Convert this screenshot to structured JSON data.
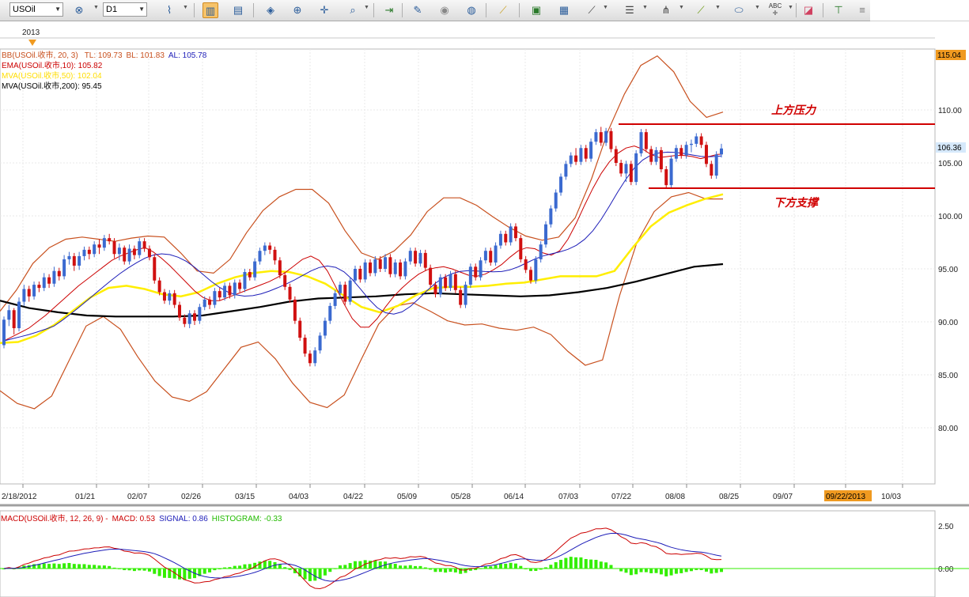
{
  "toolbar": {
    "symbol": "USOil",
    "timeframe": "D1",
    "icons": [
      "bar-chart-icon",
      "indicator-icon",
      "period-icon",
      "objects-icon",
      "zoom-in-icon",
      "zoom-out-icon",
      "crosshair-icon",
      "search-chart-icon",
      "auto-scroll-icon",
      "edit-icon",
      "eye-icon",
      "globe-icon",
      "ruler-icon",
      "picture-icon",
      "chart-window-icon",
      "trendline-icon",
      "fibonacci-icon",
      "pitchfork-icon",
      "line-tool-icon",
      "ellipse-icon",
      "text-label-icon",
      "eraser-icon",
      "tree-icon",
      "menu-icon"
    ]
  },
  "colors": {
    "bull": "#3b6ad0",
    "bear": "#d01010",
    "bb": "#c8501e",
    "ema": "#cc0000",
    "mva50": "#ffee00",
    "mva200": "#000000",
    "macd": "#cc0000",
    "signal": "#1d1db8",
    "hist": "#33ee00",
    "levels": "#d00000",
    "price_tag": "#d6e9fb",
    "date_tag": "#f09a20"
  },
  "legend": {
    "bb_name": "BB(USOil.收市, 20, 3)",
    "bb_tl": "TL: 109.73",
    "bb_bl": "BL: 101.83",
    "bb_al": "AL: 105.78",
    "ema": "EMA(USOil.收市,10): 105.82",
    "mva50": "MVA(USOil.收市,50): 102.04",
    "mva200": "MVA(USOil.收市,200): 95.45"
  },
  "annotations": {
    "resistance": "上方压力",
    "support": "下方支撑"
  },
  "year_label": "2013",
  "price_tag_top": "115.04",
  "price_tag_last": "106.36",
  "date_tag": "09/22/2013",
  "macd_legend": {
    "name": "MACD(USOil.收市, 12, 26, 9) -",
    "macd": "MACD: 0.53",
    "signal": "SIGNAL: 0.86",
    "hist": "HISTOGRAM: -0.33"
  },
  "chart_data": [
    {
      "type": "candlestick",
      "symbol": "USOil",
      "timeframe": "D1",
      "y_ticks": [
        80,
        85,
        90,
        95,
        100,
        105,
        110
      ],
      "ylim": [
        75,
        115.04
      ],
      "last_price": 106.36,
      "x_tick_labels": [
        "2/18/2012",
        "01/21",
        "02/07",
        "02/26",
        "03/15",
        "04/03",
        "04/22",
        "05/09",
        "05/28",
        "06/14",
        "07/03",
        "07/22",
        "08/08",
        "08/25",
        "09/07",
        "09/22/2013",
        "10/03"
      ],
      "ohlc": [
        [
          87.8,
          90.5,
          87.5,
          90.2
        ],
        [
          90.2,
          91.6,
          89.6,
          91.1
        ],
        [
          91.1,
          91.3,
          88.8,
          89.4
        ],
        [
          89.4,
          92.3,
          89.1,
          91.9
        ],
        [
          91.9,
          93.5,
          91.5,
          93.1
        ],
        [
          93.1,
          93.4,
          91.9,
          92.4
        ],
        [
          92.4,
          93.8,
          92.1,
          93.5
        ],
        [
          93.5,
          93.8,
          92.8,
          93.2
        ],
        [
          93.2,
          94.6,
          92.9,
          94.2
        ],
        [
          94.2,
          94.5,
          93.2,
          93.6
        ],
        [
          93.6,
          95.2,
          93.3,
          94.8
        ],
        [
          94.8,
          95.1,
          93.9,
          94.3
        ],
        [
          94.3,
          96.3,
          94.0,
          95.9
        ],
        [
          95.9,
          96.6,
          95.4,
          96.2
        ],
        [
          96.2,
          96.5,
          94.8,
          95.3
        ],
        [
          95.3,
          96.6,
          94.9,
          96.2
        ],
        [
          96.2,
          97.1,
          95.8,
          96.8
        ],
        [
          96.8,
          97.1,
          95.9,
          96.4
        ],
        [
          96.4,
          97.6,
          96.1,
          97.3
        ],
        [
          97.3,
          97.8,
          96.4,
          97.0
        ],
        [
          97.0,
          98.2,
          96.7,
          97.9
        ],
        [
          97.9,
          98.3,
          97.3,
          97.6
        ],
        [
          97.6,
          97.9,
          96.0,
          96.4
        ],
        [
          96.4,
          97.4,
          95.8,
          97.0
        ],
        [
          97.0,
          97.2,
          95.4,
          95.7
        ],
        [
          95.7,
          97.3,
          95.4,
          96.9
        ],
        [
          96.9,
          97.2,
          95.9,
          96.3
        ],
        [
          96.3,
          97.9,
          96.0,
          97.6
        ],
        [
          97.6,
          97.9,
          96.6,
          96.9
        ],
        [
          96.9,
          97.2,
          95.8,
          96.1
        ],
        [
          96.1,
          96.4,
          93.6,
          93.9
        ],
        [
          93.9,
          94.2,
          92.5,
          92.8
        ],
        [
          92.8,
          93.1,
          91.7,
          92.0
        ],
        [
          92.0,
          93.0,
          91.6,
          92.7
        ],
        [
          92.7,
          93.0,
          91.3,
          91.6
        ],
        [
          91.6,
          91.9,
          90.1,
          90.4
        ],
        [
          90.4,
          90.7,
          89.5,
          89.8
        ],
        [
          89.8,
          91.1,
          89.4,
          90.8
        ],
        [
          90.8,
          91.1,
          89.7,
          90.1
        ],
        [
          90.1,
          91.7,
          89.8,
          91.4
        ],
        [
          91.4,
          92.4,
          91.1,
          92.1
        ],
        [
          92.1,
          92.4,
          91.2,
          91.6
        ],
        [
          91.6,
          93.2,
          91.3,
          92.9
        ],
        [
          92.9,
          93.2,
          92.0,
          92.3
        ],
        [
          92.3,
          93.7,
          92.0,
          93.4
        ],
        [
          93.4,
          93.7,
          92.2,
          92.5
        ],
        [
          92.5,
          94.0,
          92.2,
          93.7
        ],
        [
          93.7,
          94.0,
          92.8,
          93.1
        ],
        [
          93.1,
          95.0,
          92.8,
          94.7
        ],
        [
          94.7,
          95.0,
          93.9,
          94.2
        ],
        [
          94.2,
          96.0,
          93.9,
          95.7
        ],
        [
          95.7,
          97.0,
          95.4,
          96.7
        ],
        [
          96.7,
          97.5,
          96.3,
          97.2
        ],
        [
          97.2,
          97.5,
          96.4,
          96.8
        ],
        [
          96.8,
          97.1,
          95.4,
          95.8
        ],
        [
          95.8,
          96.1,
          94.1,
          94.4
        ],
        [
          94.4,
          94.7,
          93.0,
          93.3
        ],
        [
          93.3,
          93.6,
          91.8,
          92.1
        ],
        [
          92.1,
          92.4,
          89.8,
          90.1
        ],
        [
          90.1,
          90.4,
          88.2,
          88.5
        ],
        [
          88.5,
          88.8,
          86.7,
          87.0
        ],
        [
          87.0,
          87.3,
          85.8,
          86.1
        ],
        [
          86.1,
          87.6,
          85.8,
          87.3
        ],
        [
          87.3,
          89.0,
          87.0,
          88.7
        ],
        [
          88.7,
          90.4,
          88.4,
          90.1
        ],
        [
          90.1,
          91.8,
          89.8,
          91.5
        ],
        [
          91.5,
          93.0,
          91.2,
          92.7
        ],
        [
          92.7,
          93.8,
          92.4,
          93.5
        ],
        [
          93.5,
          93.8,
          91.6,
          91.9
        ],
        [
          91.9,
          94.2,
          91.6,
          93.9
        ],
        [
          93.9,
          95.3,
          93.6,
          95.0
        ],
        [
          95.0,
          95.3,
          93.7,
          94.0
        ],
        [
          94.0,
          95.9,
          93.7,
          95.6
        ],
        [
          95.6,
          95.9,
          94.3,
          94.6
        ],
        [
          94.6,
          96.2,
          94.3,
          95.9
        ],
        [
          95.9,
          96.2,
          94.7,
          95.0
        ],
        [
          95.0,
          96.4,
          94.7,
          96.1
        ],
        [
          96.1,
          96.4,
          94.2,
          94.5
        ],
        [
          94.5,
          95.9,
          94.2,
          95.6
        ],
        [
          95.6,
          95.9,
          94.0,
          94.3
        ],
        [
          94.3,
          96.0,
          94.0,
          95.7
        ],
        [
          95.7,
          97.0,
          95.4,
          96.7
        ],
        [
          96.7,
          97.0,
          95.2,
          95.5
        ],
        [
          95.5,
          96.8,
          95.2,
          96.5
        ],
        [
          96.5,
          96.8,
          94.8,
          95.1
        ],
        [
          95.1,
          95.4,
          93.2,
          93.5
        ],
        [
          93.5,
          93.8,
          92.3,
          92.6
        ],
        [
          92.6,
          94.5,
          92.3,
          94.2
        ],
        [
          94.2,
          94.5,
          92.9,
          93.2
        ],
        [
          93.2,
          94.8,
          92.9,
          94.5
        ],
        [
          94.5,
          94.8,
          92.7,
          93.0
        ],
        [
          93.0,
          93.3,
          91.3,
          91.6
        ],
        [
          91.6,
          93.8,
          91.3,
          93.5
        ],
        [
          93.5,
          95.5,
          93.2,
          95.2
        ],
        [
          95.2,
          95.5,
          93.9,
          94.2
        ],
        [
          94.2,
          96.1,
          93.9,
          95.8
        ],
        [
          95.8,
          97.0,
          95.5,
          96.7
        ],
        [
          96.7,
          97.0,
          95.3,
          95.6
        ],
        [
          95.6,
          97.5,
          95.3,
          97.2
        ],
        [
          97.2,
          98.6,
          96.9,
          98.3
        ],
        [
          98.3,
          98.6,
          97.2,
          97.5
        ],
        [
          97.5,
          99.3,
          97.2,
          99.0
        ],
        [
          99.0,
          99.3,
          97.6,
          97.9
        ],
        [
          97.9,
          98.2,
          95.6,
          95.9
        ],
        [
          95.9,
          96.2,
          94.6,
          94.9
        ],
        [
          94.9,
          95.2,
          93.6,
          93.9
        ],
        [
          93.9,
          96.2,
          93.6,
          95.9
        ],
        [
          95.9,
          97.6,
          95.6,
          97.3
        ],
        [
          97.3,
          99.5,
          97.0,
          99.2
        ],
        [
          99.2,
          101.0,
          98.9,
          100.7
        ],
        [
          100.7,
          102.5,
          100.4,
          102.2
        ],
        [
          102.2,
          104.0,
          101.9,
          103.7
        ],
        [
          103.7,
          105.2,
          103.4,
          104.9
        ],
        [
          104.9,
          106.0,
          104.6,
          105.7
        ],
        [
          105.7,
          106.4,
          104.8,
          105.1
        ],
        [
          105.1,
          106.7,
          104.8,
          106.4
        ],
        [
          106.4,
          106.7,
          105.1,
          105.4
        ],
        [
          105.4,
          107.3,
          105.1,
          107.0
        ],
        [
          107.0,
          108.2,
          106.7,
          107.9
        ],
        [
          107.9,
          108.4,
          106.6,
          106.9
        ],
        [
          106.9,
          108.3,
          106.6,
          108.0
        ],
        [
          108.0,
          108.3,
          106.0,
          106.3
        ],
        [
          106.3,
          106.6,
          104.7,
          105.0
        ],
        [
          105.0,
          105.3,
          103.7,
          104.0
        ],
        [
          104.0,
          105.2,
          103.2,
          104.9
        ],
        [
          104.9,
          105.2,
          102.9,
          103.2
        ],
        [
          103.2,
          106.2,
          102.9,
          105.9
        ],
        [
          105.9,
          108.2,
          105.6,
          107.9
        ],
        [
          107.9,
          108.2,
          106.0,
          106.3
        ],
        [
          106.3,
          106.6,
          104.8,
          105.1
        ],
        [
          105.1,
          106.5,
          104.8,
          106.2
        ],
        [
          106.2,
          106.5,
          104.1,
          104.4
        ],
        [
          104.4,
          104.7,
          102.6,
          102.9
        ],
        [
          102.9,
          105.7,
          102.6,
          105.4
        ],
        [
          105.4,
          106.7,
          105.1,
          106.4
        ],
        [
          106.4,
          106.7,
          105.4,
          105.7
        ],
        [
          105.7,
          107.0,
          105.4,
          106.7
        ],
        [
          106.7,
          107.2,
          106.0,
          106.8
        ],
        [
          106.8,
          107.8,
          106.5,
          107.5
        ],
        [
          107.5,
          107.8,
          106.4,
          106.7
        ],
        [
          106.7,
          107.0,
          104.6,
          104.9
        ],
        [
          104.9,
          105.2,
          103.5,
          103.8
        ],
        [
          103.8,
          106.1,
          103.5,
          105.8
        ],
        [
          105.8,
          106.8,
          105.5,
          106.36
        ]
      ],
      "ema10": [
        88.2,
        88.6,
        89.0,
        89.4,
        90.0,
        90.6,
        91.3,
        92.0,
        92.7,
        93.4,
        94.0,
        94.6,
        95.2,
        95.8,
        96.2,
        96.5,
        96.8,
        97.0,
        96.6,
        96.0,
        95.3,
        94.5,
        93.7,
        92.9,
        92.3,
        92.0,
        92.0,
        92.3,
        92.6,
        92.9,
        93.2,
        93.5,
        93.8,
        94.2,
        94.7,
        95.3,
        95.9,
        96.2,
        95.8,
        94.8,
        93.3,
        91.7,
        90.3,
        89.5,
        89.5,
        90.3,
        91.4,
        92.4,
        93.2,
        93.9,
        94.5,
        94.9,
        95.1,
        95.2,
        95.0,
        94.7,
        94.4,
        94.3,
        94.5,
        94.9,
        95.4,
        96.1,
        96.7,
        97.0,
        96.9,
        96.5,
        96.3,
        96.7,
        97.8,
        99.3,
        101.0,
        102.6,
        104.0,
        105.1,
        105.9,
        106.4,
        106.6,
        106.3,
        105.8,
        105.5,
        105.6,
        105.7,
        105.7,
        105.6,
        105.4,
        105.6,
        105.8,
        105.82
      ],
      "ema10_x": [
        0,
        2,
        4,
        6,
        8,
        10,
        12,
        14,
        16,
        18,
        20,
        22,
        24,
        26,
        28,
        30,
        32,
        34,
        36,
        38,
        40,
        42,
        44,
        46,
        48,
        50,
        52,
        54,
        56,
        58,
        60,
        62,
        64,
        66,
        68,
        70,
        72,
        74,
        76,
        78,
        80,
        82,
        84,
        86,
        88,
        90,
        92,
        94,
        96,
        98,
        100,
        102,
        104,
        106,
        108,
        110,
        112,
        114,
        116,
        118,
        120,
        122,
        124,
        126,
        128,
        130,
        132,
        134,
        136,
        138,
        140,
        142,
        144,
        146,
        148,
        150,
        152,
        154,
        156,
        158,
        160,
        162,
        164,
        166,
        168,
        170,
        172,
        173
      ],
      "bb_upper": [
        91.0,
        93.0,
        95.5,
        97.0,
        97.8,
        98.0,
        97.8,
        97.6,
        97.9,
        98.1,
        98.0,
        96.5,
        94.8,
        94.6,
        95.9,
        98.4,
        100.5,
        101.8,
        102.5,
        102.5,
        101.2,
        98.6,
        96.5,
        95.9,
        96.7,
        98.2,
        100.4,
        101.7,
        101.7,
        101.0,
        99.9,
        98.9,
        98.1,
        97.7,
        98.0,
        99.8,
        103.5,
        108.0,
        111.5,
        114.2,
        115.1,
        113.6,
        110.8,
        109.3,
        109.8
      ],
      "bb_lower": [
        83.5,
        82.3,
        81.8,
        83.0,
        86.3,
        89.6,
        90.5,
        89.3,
        86.7,
        84.4,
        82.9,
        82.5,
        83.4,
        85.5,
        87.6,
        88.1,
        86.5,
        84.2,
        82.4,
        81.9,
        83.1,
        86.5,
        89.8,
        91.5,
        91.8,
        91.0,
        90.1,
        89.7,
        89.8,
        89.4,
        89.2,
        89.5,
        88.8,
        87.2,
        85.9,
        86.4,
        92.5,
        97.5,
        100.4,
        101.8,
        102.2,
        101.6,
        101.6
      ],
      "mva50": [
        88.0,
        88.1,
        88.7,
        89.7,
        91.0,
        92.3,
        93.2,
        93.4,
        93.1,
        92.6,
        92.4,
        92.8,
        93.6,
        94.2,
        94.6,
        94.8,
        94.7,
        94.3,
        93.6,
        92.5,
        91.4,
        90.9,
        91.5,
        92.5,
        93.2,
        93.3,
        93.3,
        93.4,
        93.6,
        93.7,
        94.0,
        94.3,
        94.3,
        94.3,
        94.8,
        97.0,
        99.0,
        100.3,
        101.0,
        101.6,
        102.04
      ],
      "mva200": [
        92.0,
        91.3,
        90.9,
        90.6,
        90.5,
        90.5,
        90.5,
        90.6,
        91.0,
        91.4,
        91.9,
        92.2,
        92.3,
        92.4,
        92.6,
        92.7,
        92.6,
        92.5,
        92.4,
        92.5,
        92.8,
        93.2,
        93.8,
        94.5,
        95.2,
        95.45
      ]
    },
    {
      "type": "macd",
      "params": [
        12,
        26,
        9
      ],
      "y_ticks": [
        0.0,
        2.5
      ],
      "macd": [
        0.53
      ],
      "signal": [
        0.86
      ],
      "histogram": [
        -0.33
      ]
    }
  ]
}
